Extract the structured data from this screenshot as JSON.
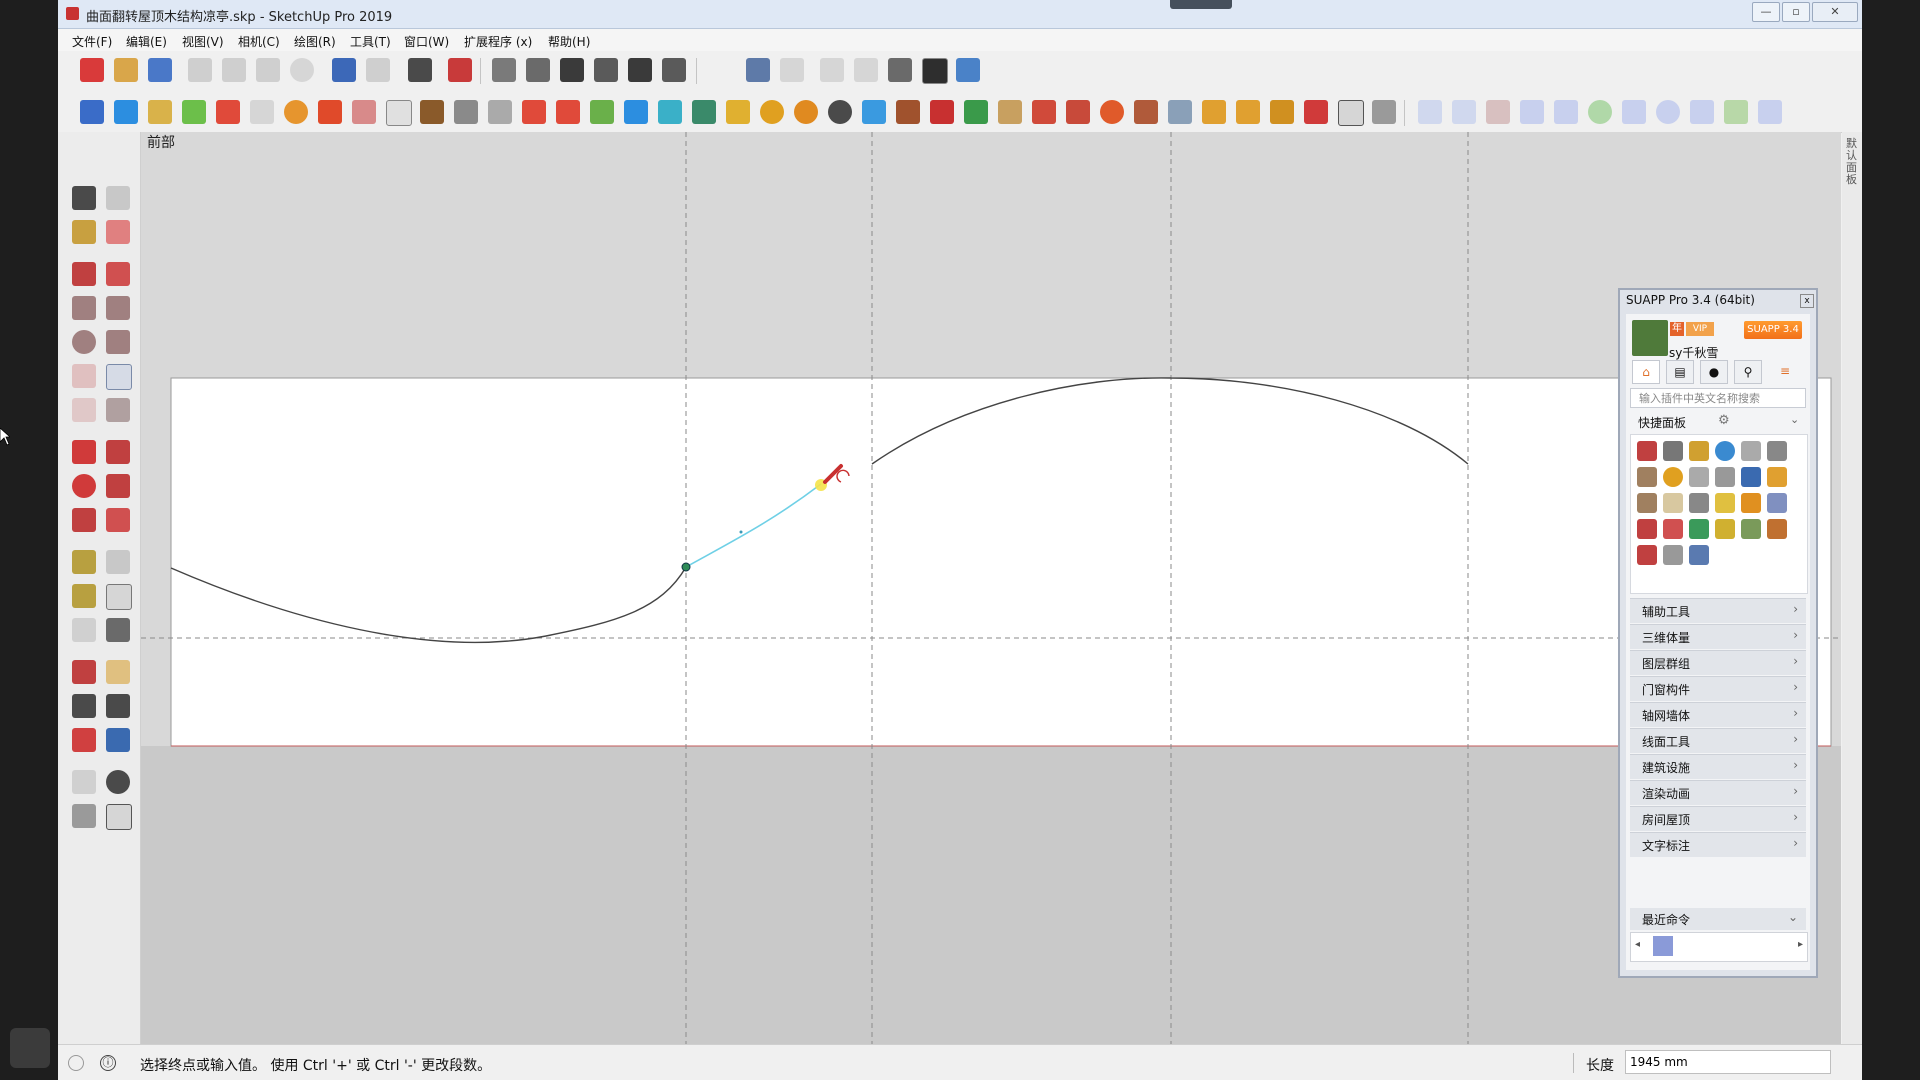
{
  "window": {
    "title": "曲面翻转屋顶木结构凉亭.skp - SketchUp Pro 2019",
    "controls": {
      "minimize": "—",
      "maximize": "▫",
      "close": "✕"
    }
  },
  "menu": [
    {
      "label": "文件(F)"
    },
    {
      "label": "编辑(E)"
    },
    {
      "label": "视图(V)"
    },
    {
      "label": "相机(C)"
    },
    {
      "label": "绘图(R)"
    },
    {
      "label": "工具(T)"
    },
    {
      "label": "窗口(W)"
    },
    {
      "label": "扩展程序 (x)"
    },
    {
      "label": "帮助(H)"
    }
  ],
  "scene": {
    "label": "前部"
  },
  "right_panel_strip": {
    "label": "默认面板"
  },
  "status": {
    "message": "选择终点或输入值。 使用 Ctrl '+' 或 Ctrl '-' 更改段数。",
    "info_icon": "ⓘ",
    "measure_label": "长度",
    "measure_value": "1945 mm"
  },
  "suapp": {
    "title": "SUAPP Pro 3.4 (64bit)",
    "close": "x",
    "username": "sy千秋雪",
    "badge_vip": "年",
    "badge_v2": "VIP",
    "version_button": "SUAPP 3.4",
    "search_placeholder": "输入插件中英文名称搜索",
    "quick_panel_title": "快捷面板",
    "categories": [
      {
        "label": "辅助工具"
      },
      {
        "label": "三维体量"
      },
      {
        "label": "图层群组"
      },
      {
        "label": "门窗构件"
      },
      {
        "label": "轴网墙体"
      },
      {
        "label": "线面工具"
      },
      {
        "label": "建筑设施"
      },
      {
        "label": "渲染动画"
      },
      {
        "label": "房间屋顶"
      },
      {
        "label": "文字标注"
      }
    ],
    "recent_title": "最近命令"
  },
  "colors": {
    "accent_orange": "#f2701a",
    "inference_point": "#2e8b57",
    "rubber_band": "#6fd0e6",
    "curve": "#444444",
    "axis_red": "#c25a5a"
  }
}
